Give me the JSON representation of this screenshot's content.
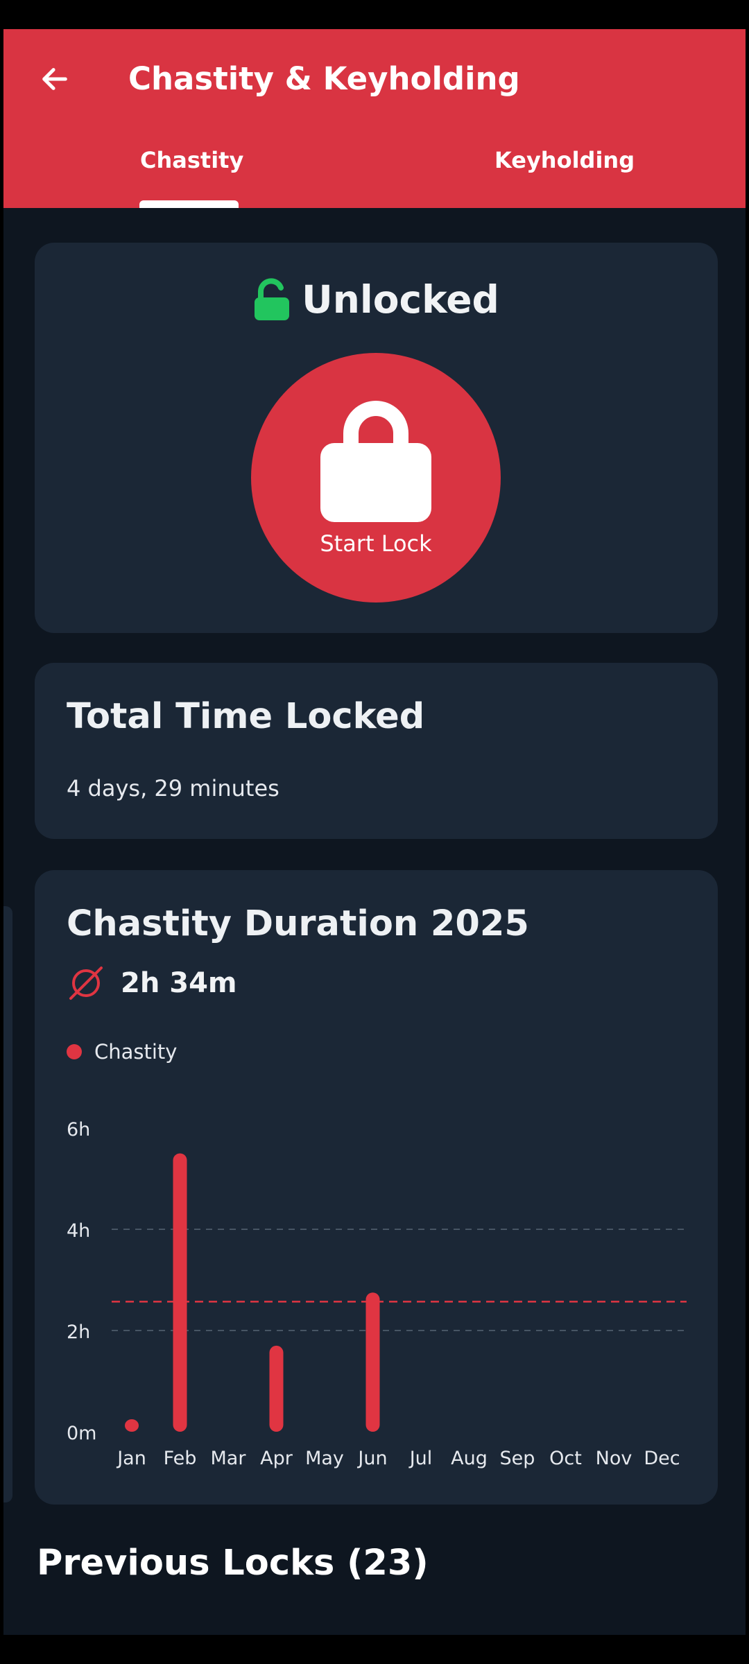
{
  "header": {
    "title": "Chastity & Keyholding",
    "back_icon": "arrow-left-icon",
    "color": "#d93442"
  },
  "tabs": [
    {
      "label": "Chastity",
      "selected": true
    },
    {
      "label": "Keyholding",
      "selected": false
    }
  ],
  "status_card": {
    "status": "Unlocked",
    "status_icon": "unlocked-padlock-icon",
    "status_color": "#22c55e",
    "button_label": "Start Lock",
    "button_icon": "padlock-icon"
  },
  "total_card": {
    "title": "Total Time Locked",
    "value": "4 days, 29 minutes"
  },
  "duration_card": {
    "title": "Chastity Duration 2025",
    "average_icon": "average-diameter-icon",
    "average_value": "2h 34m"
  },
  "chart_data": {
    "type": "bar",
    "series": [
      {
        "name": "Chastity",
        "color": "#e03542",
        "values": [
          0.1,
          5.5,
          0,
          1.7,
          0,
          2.75,
          0,
          0,
          0,
          0,
          0,
          0
        ]
      }
    ],
    "categories": [
      "Jan",
      "Feb",
      "Mar",
      "Apr",
      "May",
      "Jun",
      "Jul",
      "Aug",
      "Sep",
      "Oct",
      "Nov",
      "Dec"
    ],
    "y_ticks": [
      "0m",
      "2h",
      "4h",
      "6h"
    ],
    "ylim": [
      0,
      6
    ],
    "y_unit": "hours",
    "average_line": 2.57,
    "grid": true,
    "legend": "top-left"
  },
  "previous_locks": {
    "title": "Previous Locks (23)"
  }
}
